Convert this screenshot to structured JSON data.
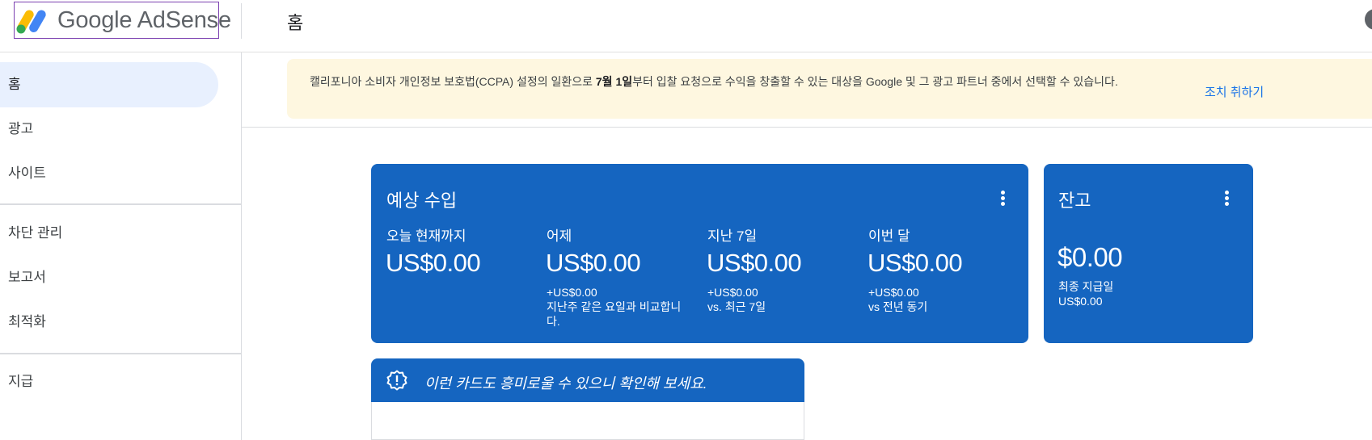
{
  "header": {
    "logo_text": "Google AdSense",
    "page_title": "홈"
  },
  "sidebar": {
    "items": [
      {
        "label": "홈",
        "active": true
      },
      {
        "label": "광고"
      },
      {
        "label": "사이트"
      },
      {
        "label": "차단 관리"
      },
      {
        "label": "보고서"
      },
      {
        "label": "최적화"
      },
      {
        "label": "지급"
      }
    ]
  },
  "banner": {
    "text_before": "캘리포니아 소비자 개인정보 보호법(CCPA) 설정의 일환으로 ",
    "text_bold": "7월 1일",
    "text_after": "부터 입찰 요청으로 수익을 창출할 수 있는 대상을 Google 및 그 광고 파트너 중에서 선택할 수 있습니다.",
    "action": "조치 취하기"
  },
  "earnings_card": {
    "title": "예상 수입",
    "metrics": [
      {
        "label": "오늘 현재까지",
        "value": "US$0.00",
        "sub1": "",
        "sub2": ""
      },
      {
        "label": "어제",
        "value": "US$0.00",
        "sub1": "+US$0.00",
        "sub2": "지난주 같은 요일과 비교합니다."
      },
      {
        "label": "지난 7일",
        "value": "US$0.00",
        "sub1": "+US$0.00",
        "sub2": "vs. 최근 7일"
      },
      {
        "label": "이번 달",
        "value": "US$0.00",
        "sub1": "+US$0.00",
        "sub2": "vs 전년 동기"
      }
    ]
  },
  "balance_card": {
    "title": "잔고",
    "value": "$0.00",
    "sub1": "최종 지급일",
    "sub2": "US$0.00"
  },
  "tip_card": {
    "text": "이런 카드도 흥미로울 수 있으니 확인해 보세요."
  },
  "colors": {
    "card_blue": "#1565c0",
    "banner_bg": "#fef7e0",
    "link_blue": "#1a73e8",
    "active_nav": "#e8f0fe"
  }
}
